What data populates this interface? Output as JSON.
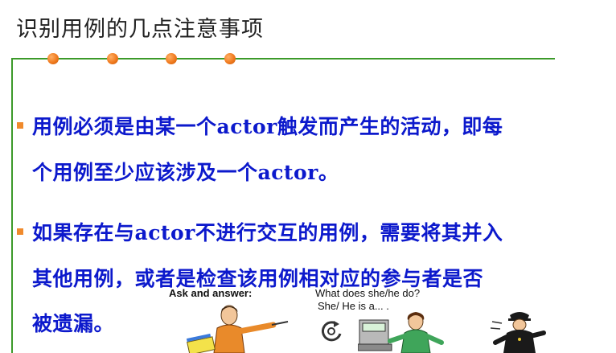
{
  "slide": {
    "title": "识别用例的几点注意事项"
  },
  "bullets": [
    {
      "lines": [
        "用例必须是由某一个actor触发而产生的活动，即每",
        "个用例至少应该涉及一个actor。"
      ]
    },
    {
      "lines": [
        "如果存在与actor不进行交互的用例，需要将其并入",
        "其他用例，或者是检查该用例相对应的参与者是否",
        "被遗漏。"
      ]
    }
  ],
  "clipart": {
    "label": "Ask and answer:",
    "question": "What does she/he do?",
    "answer": "She/ He is a... ."
  },
  "colors": {
    "accent_line": "#3c9a2a",
    "bullet_marker": "#f08a2c",
    "body_text": "#0c19cc"
  }
}
